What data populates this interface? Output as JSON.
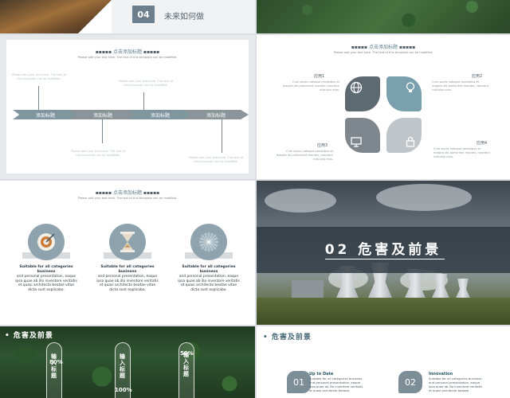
{
  "colors": {
    "accent": "#6d7f8c",
    "teal": "#7ba0ad",
    "gray": "#9aa3a9",
    "dark": "#4f5a61",
    "text": "#2f3a42"
  },
  "slide1": {
    "number": "04",
    "title": "未来如何做"
  },
  "slide3": {
    "heading": "点击添加标题",
    "subtitle": "Please add your text here. The text of this template can be modified.",
    "steps": [
      "添加标题",
      "添加标题",
      "添加标题",
      "添加标题"
    ],
    "placeholder": "Please add your text here. The text of this template can be modified."
  },
  "slide4": {
    "heading": "点击添加标题",
    "subtitle": "Please add your text here. The text of this template can be modified.",
    "items": [
      {
        "label": "应用1",
        "text": "Cum sociis natoque penatibus et magnis dis parturient montes, nascetur ridiculus mus."
      },
      {
        "label": "应用2",
        "text": "Cum sociis natoque penatibus et magnis dis parturient montes, nascetur ridiculus mus."
      },
      {
        "label": "应用3",
        "text": "Cum sociis natoque penatibus et magnis dis parturient montes, nascetur ridiculus mus."
      },
      {
        "label": "应用4",
        "text": "Cum sociis natoque penatibus et magnis dis parturient montes, nascetur ridiculus mus."
      }
    ],
    "icons": [
      "globe-icon",
      "lightbulb-icon",
      "monitor-icon",
      "lock-icon"
    ]
  },
  "slide5": {
    "heading": "点击添加标题",
    "subtitle": "Please add your text here. The text of this template can be modified.",
    "features": [
      {
        "title": "Suitable for all categories business",
        "text": "and personal presentation, eaque ipsa quae ab illo inventore veritatis et quasi architecto beatae vitae dicta sunt explicabo.",
        "icon": "target-icon"
      },
      {
        "title": "Suitable for all categories business",
        "text": "and personal presentation, eaque ipsa quae ab illo inventore veritatis et quasi architecto beatae vitae dicta sunt explicabo.",
        "icon": "hourglass-icon"
      },
      {
        "title": "Suitable for all categories business",
        "text": "and personal presentation, eaque ipsa quae ab illo inventore veritatis et quasi architecto beatae vitae dicta sunt explicabo.",
        "icon": "dandelion-icon"
      }
    ]
  },
  "slide6": {
    "title": "02  危害及前景"
  },
  "slide7": {
    "title": "危害及前景",
    "pills": [
      {
        "label": "输入标题",
        "value": "80%"
      },
      {
        "label": "输入标题",
        "value": "100%"
      },
      {
        "label": "输入标题",
        "value": "50%"
      }
    ]
  },
  "slide8": {
    "title": "危害及前景",
    "items": [
      {
        "num": "01",
        "title": "Up to Date",
        "text": "Suitable for all categories business and personal presentation, eaque ipsa quae ab illo inventore veritatis et quasi architecto beatae."
      },
      {
        "num": "02",
        "title": "Innovation",
        "text": "Suitable for all categories business and personal presentation, eaque ipsa quae ab illo inventore veritatis et quasi architecto beatae."
      }
    ]
  }
}
